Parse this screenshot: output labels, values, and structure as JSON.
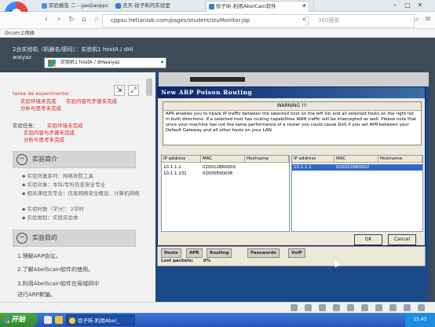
{
  "tabs": [
    {
      "label": "实验报告 二 - gaojiaoppc",
      "active": false
    },
    {
      "label": "去天-徐子昕的实验室",
      "active": false
    },
    {
      "label": "徐子昕-利用AbelCain软件",
      "active": true
    }
  ],
  "nav": {
    "url": "cppsu.hetianlab.com/pages/student/stuMonitor.jsp",
    "search_placeholder": "360搜索"
  },
  "bookmarks": {
    "item": "Drcom上网器"
  },
  "topinfo": {
    "line1": "2台实验机（机器名/密码）：实验机1  hostA / dHi",
    "line2": "waiyaz",
    "machine_select": "实验机1  hostA / dHwaiyaz"
  },
  "experiment": {
    "tarea_label": "tarea de experimento:",
    "tarea_items": [
      "实验环境未完成",
      "实验内容可步骤未完成",
      "分析与思考未完成"
    ],
    "task_label": "实验任务：",
    "task_items": [
      "实验环境未完成",
      "实验内容与步骤未完成",
      "分析与思考未完成"
    ]
  },
  "intro": {
    "title": "实验简介",
    "bullets": [
      "实验所属系列：网络攻防工具",
      "实验对象：本科/专科信息安全专业",
      "相关课程及专业：信息网络安全概论、计算机网络",
      "实验时数（学分）：2学时",
      "实验类别：实践实验类"
    ]
  },
  "objective": {
    "title": "实验目的",
    "items": [
      "1.理解ARP协议。",
      "2.了解AbelScain软件的使用。",
      "3.利用AbelScain软件在局域网中",
      "进行ARP欺骗。"
    ]
  },
  "dialog": {
    "title": "New ARP Poison Routing",
    "warn_title": "WARNING !!!",
    "warn_text": "APR enables you to hijack IP traffic between the selected host on the left list and all selected hosts on the right list in both directions. If a selected host has routing capabilities WAN traffic will be intercepted as well. Please note that since your machine has not the same performance of a router you could cause DoS if you set APR between your Default Gateway and all other hosts on your LAN.",
    "left_cols": [
      "IP address",
      "MAC",
      "Hostname"
    ],
    "left_rows": [
      {
        "ip": "10.1.1.1",
        "mac": "020012B60002",
        "host": ""
      },
      {
        "ip": "10.1.1.231",
        "mac": "02005E9000E",
        "host": ""
      }
    ],
    "right_cols": [
      "IP address",
      "MAC",
      "Hostname"
    ],
    "right_rows": [
      {
        "ip": "10.1.1.1",
        "mac": "020012B60002",
        "host": ""
      }
    ],
    "ok": "OK",
    "cancel": "Cancel"
  },
  "app": {
    "tabs": [
      "Hosts",
      "APR",
      "Routing",
      "Passwords",
      "VoIP"
    ],
    "lost_packets_label": "Lost packets:",
    "lost_packets_value": "0%"
  },
  "taskbar": {
    "start": "开始",
    "task": "徐子昕-利用Abel_",
    "clock": "15:45"
  }
}
